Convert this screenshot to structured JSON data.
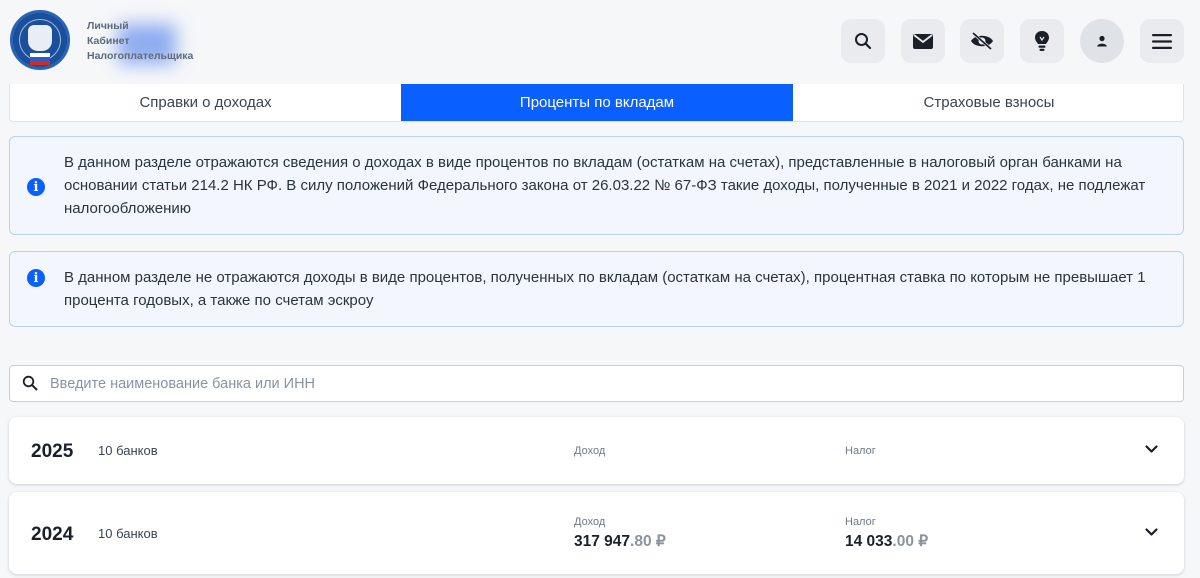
{
  "header": {
    "brand_lines": [
      "Личный",
      "Кабинет",
      "Налогоплательщика"
    ],
    "icons": [
      "search-icon",
      "mail-icon",
      "eye-hidden-icon",
      "lightbulb-icon",
      "user-icon",
      "menu-icon"
    ]
  },
  "tabs": [
    {
      "label": "Справки о доходах",
      "active": false
    },
    {
      "label": "Проценты по вкладам",
      "active": true
    },
    {
      "label": "Страховые взносы",
      "active": false
    }
  ],
  "info": [
    {
      "text": "В данном разделе отражаются сведения о доходах в виде процентов по вкладам (остаткам на счетах), представленные в налоговый орган банками на основании статьи 214.2 НК РФ. В силу положений Федерального закона от 26.03.22 № 67-ФЗ такие доходы, полученные в 2021 и 2022 годах, не подлежат налогообложению"
    },
    {
      "text": "В данном разделе не отражаются доходы в виде процентов, полученных по вкладам (остаткам на счетах), процентная ставка по которым не превышает 1 процента годовых, а также по счетам эскроу"
    }
  ],
  "search": {
    "placeholder": "Введите наименование банка или ИНН",
    "value": ""
  },
  "years": [
    {
      "year": "2025",
      "banks": "10 банков",
      "income_label": "Доход",
      "tax_label": "Налог",
      "income_int": "",
      "income_frac": "",
      "tax_int": "",
      "tax_frac": ""
    },
    {
      "year": "2024",
      "banks": "10 банков",
      "income_label": "Доход",
      "tax_label": "Налог",
      "income_int": "317 947",
      "income_frac": ".80 ₽",
      "tax_int": "14 033",
      "tax_frac": ".00 ₽"
    }
  ],
  "colors": {
    "accent": "#0a5fff",
    "info_bg": "#f3f7fd",
    "info_border": "#b9d2f0"
  }
}
